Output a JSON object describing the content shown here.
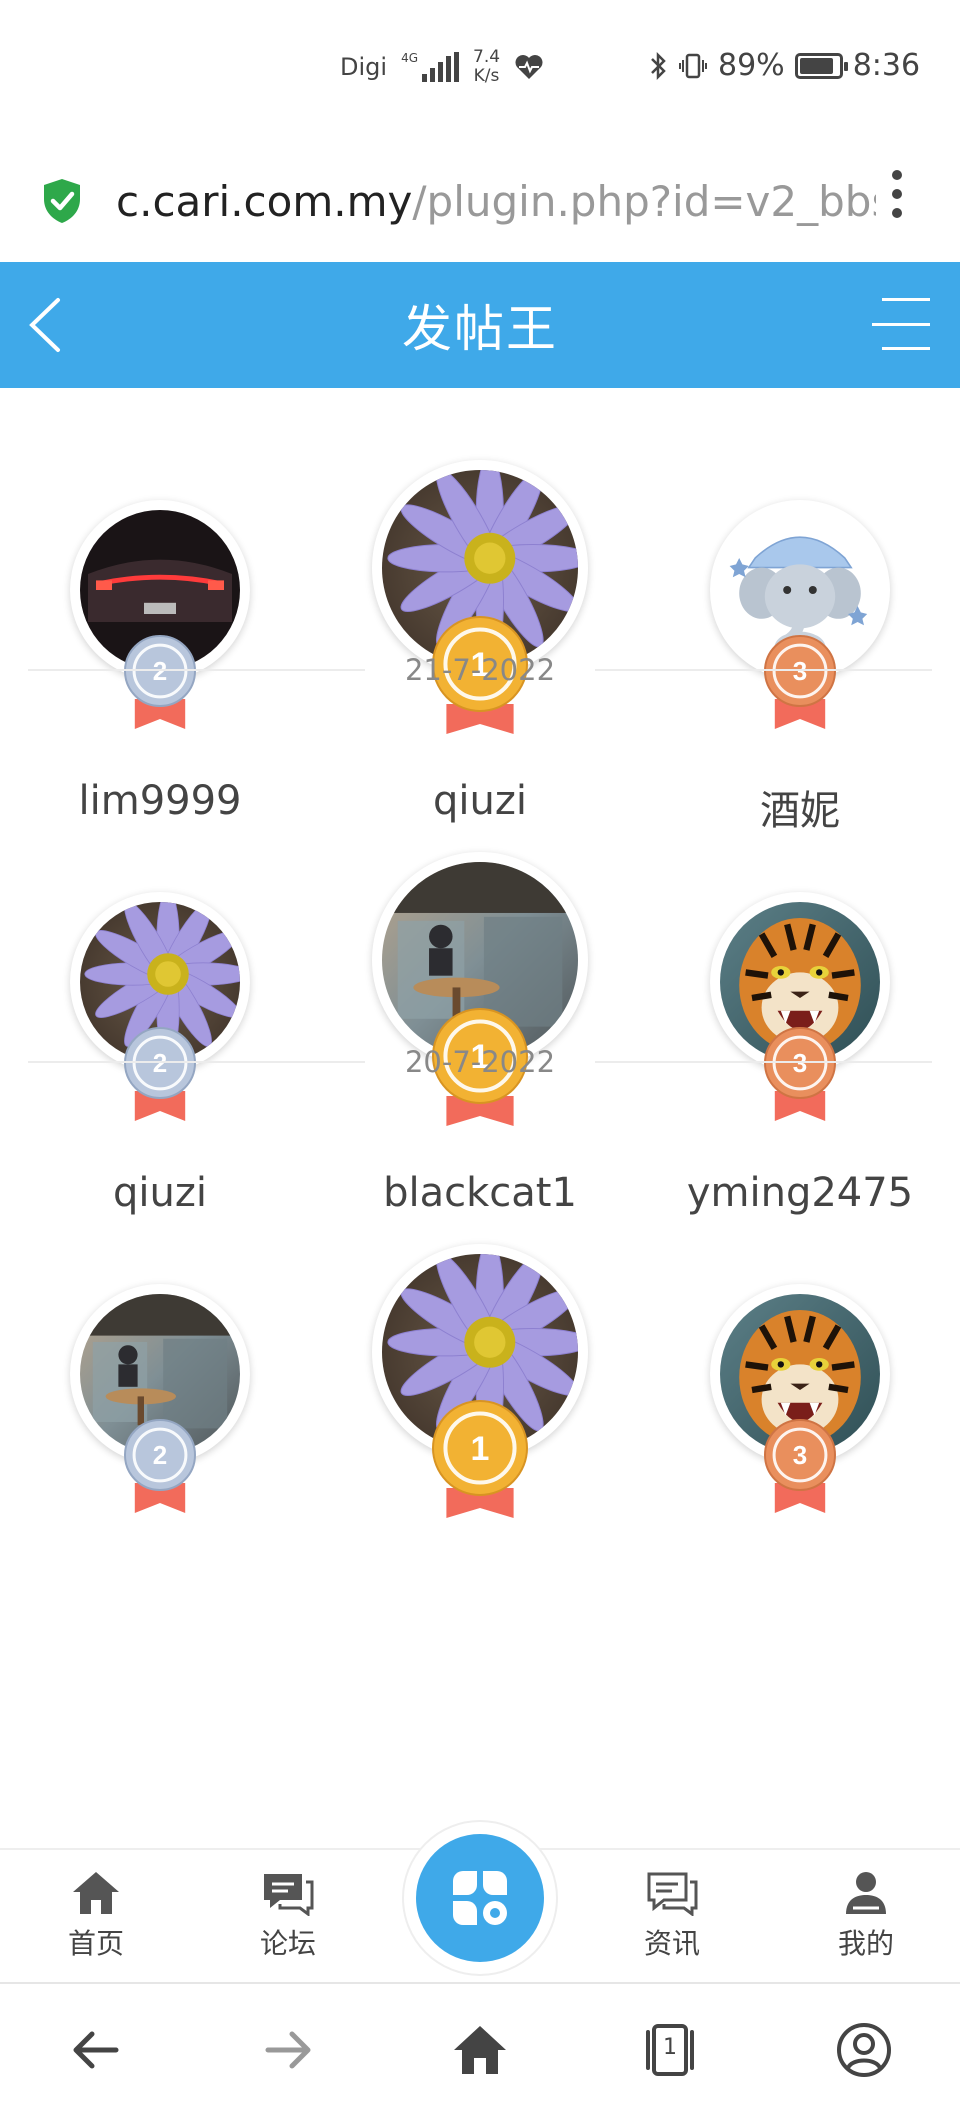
{
  "status_bar": {
    "carrier": "Digi",
    "network_type": "4G",
    "data_rate_value": "7.4",
    "data_rate_unit": "K/s",
    "battery_percent": "89%",
    "battery_level": 0.89,
    "time": "8:36",
    "icons": [
      "signal-icon",
      "heart-rate-icon",
      "bluetooth-icon",
      "vibrate-icon",
      "battery-icon"
    ]
  },
  "browser": {
    "url_host": "c.cari.com.my",
    "url_path": "/plugin.php?id=v2_bbs",
    "secure_icon": "shield-check-icon",
    "menu_icon": "more-vert-icon"
  },
  "header": {
    "title": "发帖王",
    "back_icon": "chevron-left-icon",
    "menu_icon": "hamburger-menu-icon"
  },
  "rankings": [
    {
      "date": "",
      "users": [
        {
          "rank": "2",
          "name": "lim9999",
          "avatar": "car-taillight-photo"
        },
        {
          "rank": "1",
          "name": "qiuzi",
          "avatar": "purple-daisy-photo"
        },
        {
          "rank": "3",
          "name": "酒妮",
          "avatar": "cartoon-elephant"
        }
      ]
    },
    {
      "date": "21-7-2022",
      "users": [
        {
          "rank": "2",
          "name": "qiuzi",
          "avatar": "purple-daisy-photo"
        },
        {
          "rank": "1",
          "name": "blackcat1",
          "avatar": "cafe-window-photo"
        },
        {
          "rank": "3",
          "name": "yming2475",
          "avatar": "tiger-photo"
        }
      ]
    },
    {
      "date": "20-7-2022",
      "users": [
        {
          "rank": "2",
          "name": "",
          "avatar": "cafe-window-photo"
        },
        {
          "rank": "1",
          "name": "",
          "avatar": "purple-daisy-photo"
        },
        {
          "rank": "3",
          "name": "",
          "avatar": "tiger-photo"
        }
      ]
    }
  ],
  "colors": {
    "brand": "#3fa9e9",
    "gold": "#f2b233",
    "silver": "#b8c6dc",
    "bronze": "#e98f5d",
    "ribbon": "#f26b5b"
  },
  "bottom_nav": {
    "items": [
      {
        "label": "首页",
        "icon": "home-icon"
      },
      {
        "label": "论坛",
        "icon": "forum-chat-icon"
      },
      {
        "label": "",
        "icon": "apps-clover-icon"
      },
      {
        "label": "资讯",
        "icon": "news-chat-icon"
      },
      {
        "label": "我的",
        "icon": "user-profile-icon"
      }
    ]
  },
  "system_nav": {
    "icons": [
      "back-arrow-icon",
      "forward-arrow-icon",
      "browser-home-icon",
      "tabs-icon",
      "account-icon"
    ],
    "tab_count": "1"
  }
}
